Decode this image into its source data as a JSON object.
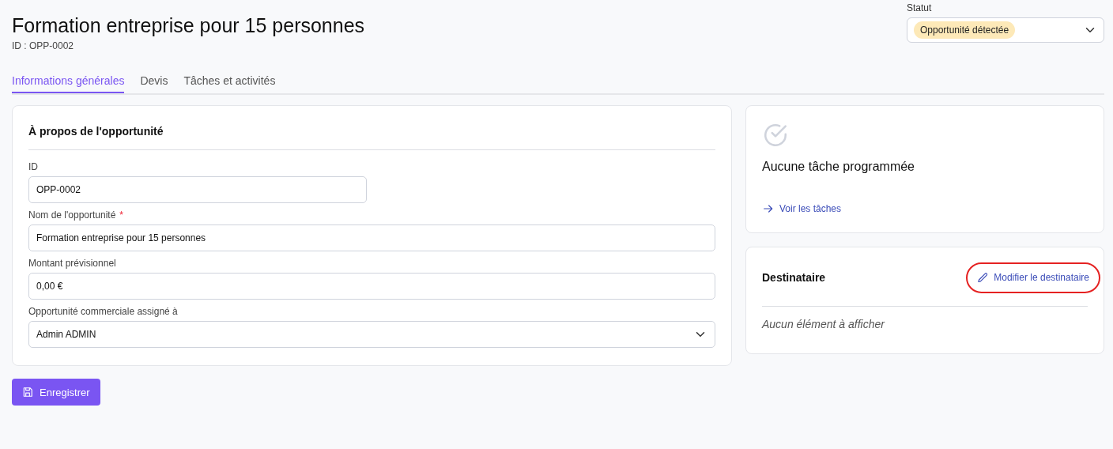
{
  "header": {
    "title": "Formation entreprise pour 15 personnes",
    "subtitle": "ID : OPP-0002"
  },
  "status": {
    "label": "Statut",
    "value": "Opportunité détectée"
  },
  "tabs": [
    {
      "label": "Informations générales",
      "selected": true
    },
    {
      "label": "Devis",
      "selected": false
    },
    {
      "label": "Tâches et activités",
      "selected": false
    }
  ],
  "form_card": {
    "title": "À propos de l'opportunité",
    "fields": [
      {
        "label": "ID",
        "kind": "short_text",
        "value": "OPP-0002",
        "required": false
      },
      {
        "label": "Nom de l'opportunité",
        "kind": "text",
        "value": "Formation entreprise pour 15 personnes",
        "required": true
      },
      {
        "label": "Montant prévisionnel",
        "kind": "text",
        "value": "0,00 €",
        "required": false
      },
      {
        "label": "Opportunité commerciale assigné à",
        "kind": "select",
        "value": "Admin ADMIN",
        "required": false
      }
    ],
    "required_marker": "*"
  },
  "tasks_card": {
    "message": "Aucune tâche programmée",
    "link": "Voir les tâches"
  },
  "recipient_card": {
    "title": "Destinataire",
    "action": {
      "label": "Modifier le destinataire",
      "highlighted": true
    },
    "empty": "Aucun élément à afficher"
  },
  "save_button": "Enregistrer"
}
